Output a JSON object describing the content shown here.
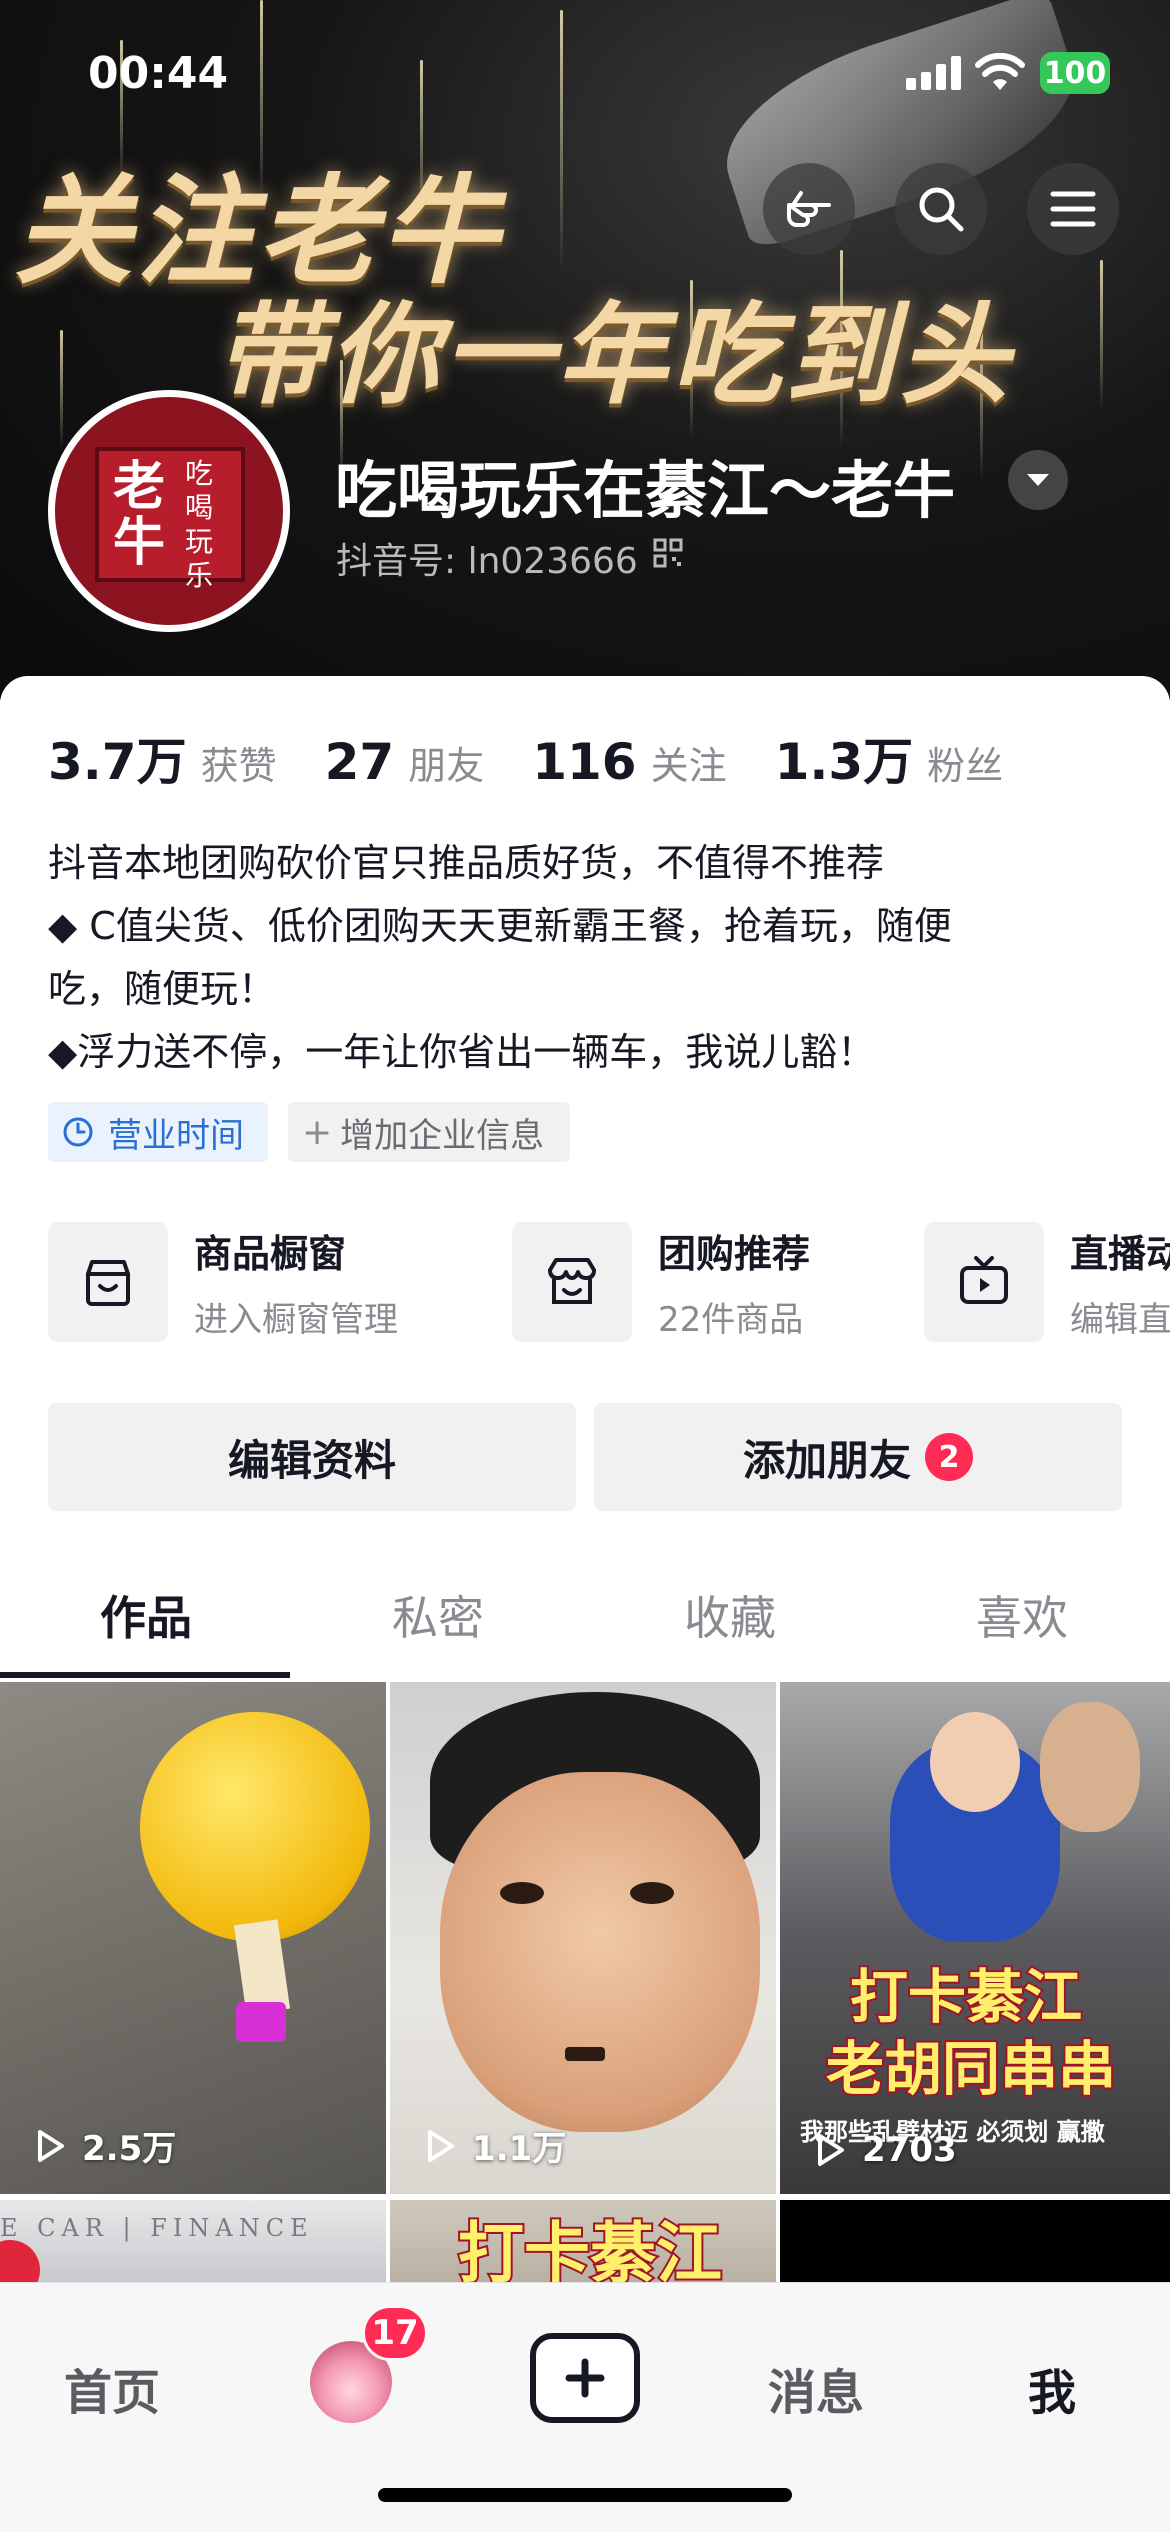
{
  "status_bar": {
    "time": "00:44",
    "battery": "100"
  },
  "banner": {
    "slogan_line1": "关注老牛",
    "slogan_line2": "带你一年吃到头"
  },
  "profile": {
    "avatar_text_big": "老牛",
    "avatar_text_small": "吃喝玩乐",
    "name": "吃喝玩乐在綦江～老牛",
    "douyin_id": "抖音号: ln023666"
  },
  "stats": [
    {
      "num": "3.7万",
      "label": "获赞"
    },
    {
      "num": "27",
      "label": "朋友"
    },
    {
      "num": "116",
      "label": "关注"
    },
    {
      "num": "1.3万",
      "label": "粉丝"
    }
  ],
  "bio": [
    "抖音本地团购砍价官只推品质好货，不值得不推荐",
    "◆ C值尖货、低价团购天天更新霸王餐，抢着玩，随便",
    "吃，随便玩！",
    "◆浮力送不停，一年让你省出一辆车，我说儿豁！"
  ],
  "chips": {
    "business_hours": "营业时间",
    "add_info": "增加企业信息"
  },
  "features": [
    {
      "title": "商品橱窗",
      "sub": "进入橱窗管理"
    },
    {
      "title": "团购推荐",
      "sub": "22件商品"
    },
    {
      "title": "直播动",
      "sub": "编辑直"
    }
  ],
  "actions": {
    "edit": "编辑资料",
    "add_friends": "添加朋友",
    "add_friends_badge": "2"
  },
  "tabs": [
    "作品",
    "私密",
    "收藏",
    "喜欢"
  ],
  "videos": [
    {
      "plays": "2.5万"
    },
    {
      "plays": "1.1万"
    },
    {
      "plays": "2703",
      "overlay1": "打卡綦江",
      "overlay2": "老胡同串串",
      "caption": "我那些乱劈材迈 必须划 赢撒"
    },
    {
      "overlay1": "打卡綦江"
    },
    {
      "text": "E CAR | FINANCE"
    }
  ],
  "bottom_nav": {
    "home": "首页",
    "messages_badge": "17",
    "messages": "消息",
    "me": "我"
  }
}
